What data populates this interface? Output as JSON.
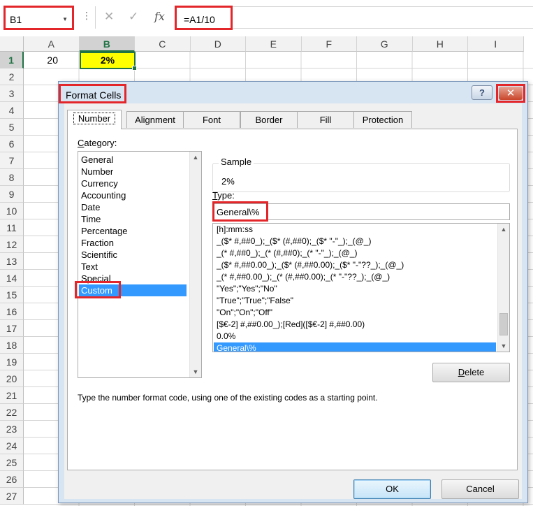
{
  "formula_bar": {
    "name_box": "B1",
    "dots": "⋮",
    "cancel_glyph": "✕",
    "enter_glyph": "✓",
    "fx_glyph": "fx",
    "formula": "=A1/10"
  },
  "sheet": {
    "columns": [
      "A",
      "B",
      "C",
      "D",
      "E",
      "F",
      "G",
      "H",
      "I"
    ],
    "selected_column": "B",
    "rows": [
      "1",
      "2",
      "3",
      "4",
      "5",
      "6",
      "7",
      "8",
      "9",
      "10",
      "11",
      "12",
      "13",
      "14",
      "15",
      "16",
      "17",
      "18",
      "19",
      "20",
      "21",
      "22",
      "23",
      "24",
      "25",
      "26",
      "27"
    ],
    "cells": {
      "A1": "20",
      "B1": "2%"
    },
    "b1_fill": "#ffff00",
    "selection_color": "#217346"
  },
  "dialog": {
    "title": "Format Cells",
    "help_glyph": "?",
    "close_glyph": "✕",
    "tabs": [
      {
        "label": "Number",
        "active": true
      },
      {
        "label": "Alignment",
        "active": false
      },
      {
        "label": "Font",
        "active": false
      },
      {
        "label": "Border",
        "active": false
      },
      {
        "label": "Fill",
        "active": false
      },
      {
        "label": "Protection",
        "active": false
      }
    ],
    "category_label_prefix": "C",
    "category_label_rest": "ategory:",
    "categories": [
      "General",
      "Number",
      "Currency",
      "Accounting",
      "Date",
      "Time",
      "Percentage",
      "Fraction",
      "Scientific",
      "Text",
      "Special",
      "Custom"
    ],
    "selected_category": "Custom",
    "sample_label": "Sample",
    "sample_value": "2%",
    "type_label_prefix": "T",
    "type_label_rest": "ype:",
    "type_value": "General\\%",
    "type_list": [
      "[h]:mm:ss",
      "_($* #,##0_);_($* (#,##0);_($* \"-\"_);_(@_)",
      "_(* #,##0_);_(* (#,##0);_(* \"-\"_);_(@_)",
      "_($* #,##0.00_);_($* (#,##0.00);_($* \"-\"??_);_(@_)",
      "_(* #,##0.00_);_(* (#,##0.00);_(* \"-\"??_);_(@_)",
      "\"Yes\";\"Yes\";\"No\"",
      "\"True\";\"True\";\"False\"",
      "\"On\";\"On\";\"Off\"",
      "[$€-2] #,##0.00_);[Red]([$€-2] #,##0.00)",
      "0.0%",
      "General\\%"
    ],
    "selected_type": "General\\%",
    "delete_prefix": "D",
    "delete_rest": "elete",
    "hint": "Type the number format code, using one of the existing codes as a starting point.",
    "ok_label": "OK",
    "cancel_label": "Cancel",
    "highlight_color": "#e3262a",
    "selection_blue": "#3399ff"
  }
}
